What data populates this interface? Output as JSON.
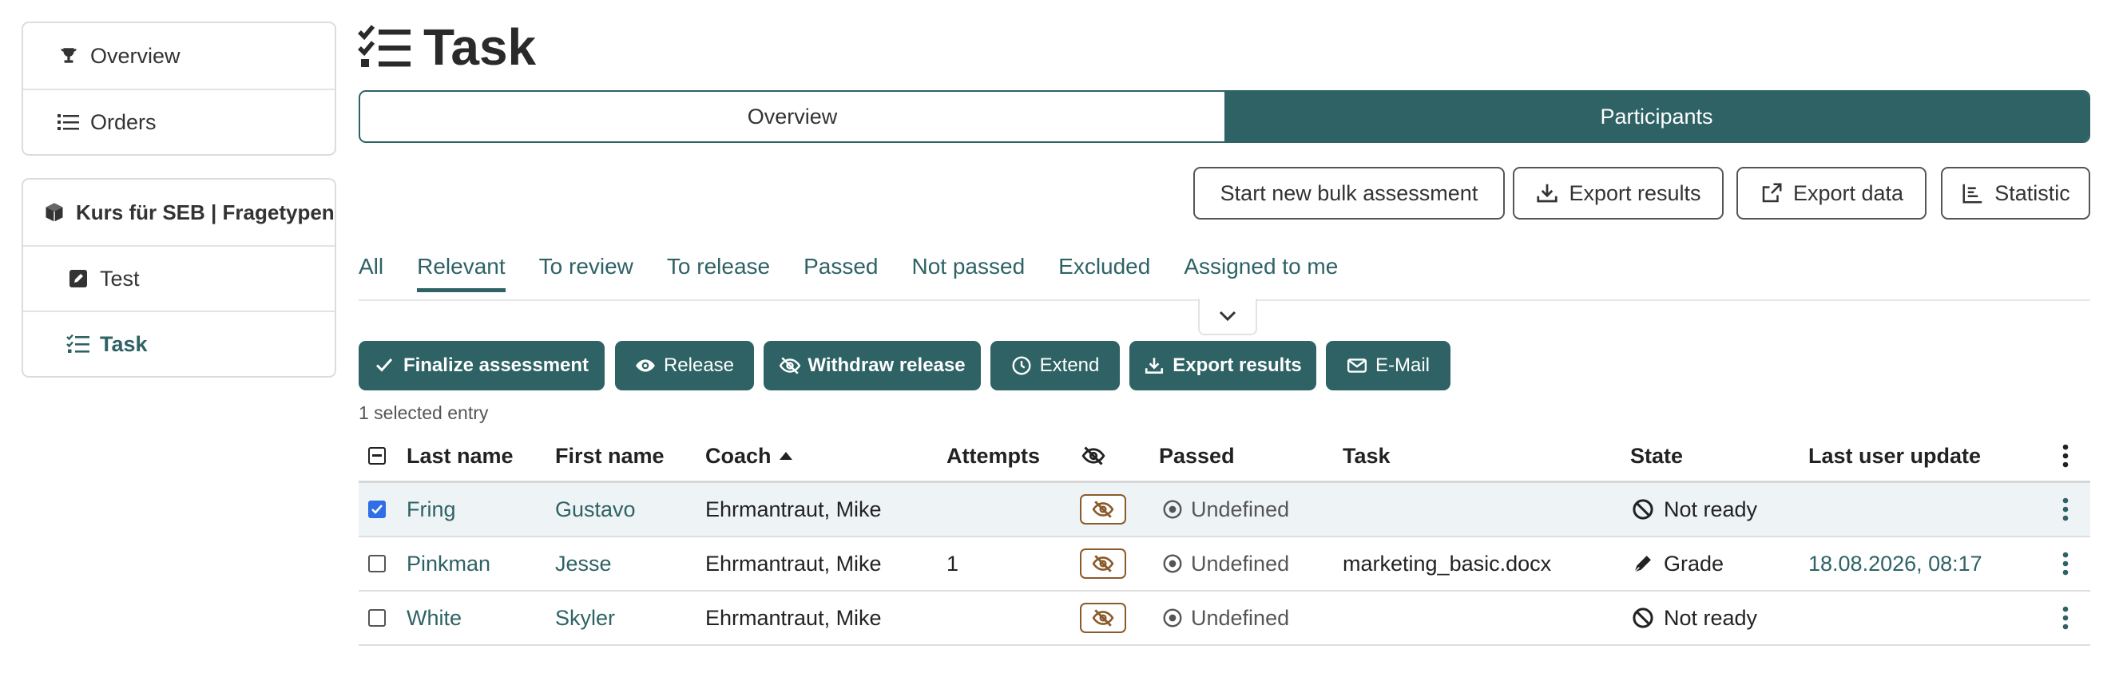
{
  "nav": {
    "top_items": [
      {
        "label": "Overview",
        "icon": "trophy-icon"
      },
      {
        "label": "Orders",
        "icon": "list-icon"
      }
    ],
    "course": {
      "label": "Kurs für SEB | Fragetypen",
      "icon": "cube-icon"
    },
    "children": [
      {
        "label": "Test",
        "icon": "edit-square-icon",
        "active": false
      },
      {
        "label": "Task",
        "icon": "task-list-icon",
        "active": true
      }
    ]
  },
  "page_title": "Task",
  "segments": {
    "overview": "Overview",
    "participants": "Participants",
    "active": "participants"
  },
  "toolbar": {
    "bulk": "Start new bulk assessment",
    "export_results": "Export results",
    "export_data": "Export data",
    "statistic": "Statistic"
  },
  "filters": [
    "All",
    "Relevant",
    "To review",
    "To release",
    "Passed",
    "Not passed",
    "Excluded",
    "Assigned to me"
  ],
  "active_filter": "Relevant",
  "actions": {
    "finalize": "Finalize assessment",
    "release": "Release",
    "withdraw": "Withdraw release",
    "extend": "Extend",
    "export": "Export results",
    "email": "E-Mail"
  },
  "selection_info": "1 selected entry",
  "table": {
    "headers": {
      "last_name": "Last name",
      "first_name": "First name",
      "coach": "Coach",
      "attempts": "Attempts",
      "passed": "Passed",
      "task": "Task",
      "state": "State",
      "last_update": "Last user update"
    },
    "sort_column": "coach",
    "rows": [
      {
        "selected": true,
        "last_name": "Fring",
        "first_name": "Gustavo",
        "coach": "Ehrmantraut, Mike",
        "attempts": "",
        "passed": "Undefined",
        "task": "",
        "state": "Not ready",
        "state_icon": "ban-icon",
        "last_update": ""
      },
      {
        "selected": false,
        "last_name": "Pinkman",
        "first_name": "Jesse",
        "coach": "Ehrmantraut, Mike",
        "attempts": "1",
        "passed": "Undefined",
        "task": "marketing_basic.docx",
        "state": "Grade",
        "state_icon": "pen-icon",
        "last_update": "18.08.2026, 08:17"
      },
      {
        "selected": false,
        "last_name": "White",
        "first_name": "Skyler",
        "coach": "Ehrmantraut, Mike",
        "attempts": "",
        "passed": "Undefined",
        "task": "",
        "state": "Not ready",
        "state_icon": "ban-icon",
        "last_update": ""
      }
    ]
  },
  "colors": {
    "accent": "#2e6265",
    "checkbox": "#2f6ee6",
    "badge_border": "#8b5a2b"
  }
}
